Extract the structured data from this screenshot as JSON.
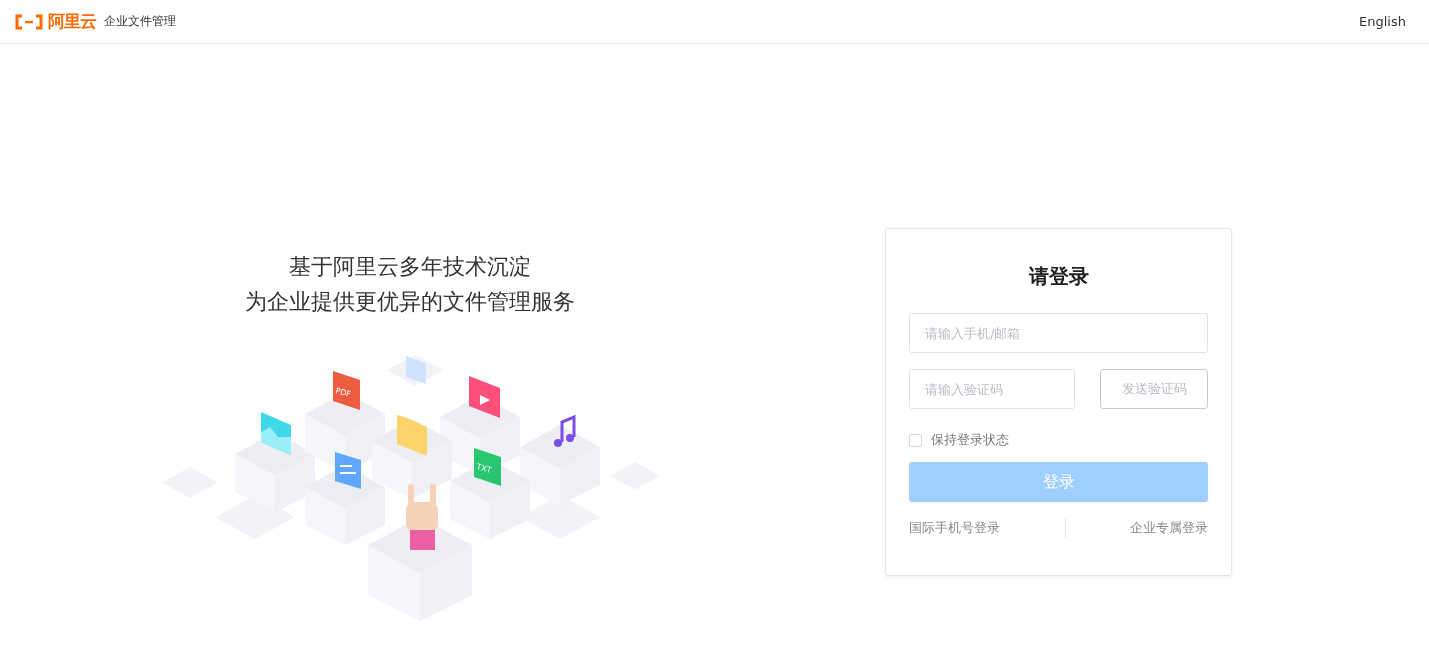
{
  "header": {
    "brand": "阿里云",
    "product": "企业文件管理",
    "language": "English"
  },
  "slogan": [
    "基于阿里云多年技术沉淀",
    "为企业提供更优异的文件管理服务"
  ],
  "illustration": {
    "labels": [
      "PDF",
      "TXT"
    ]
  },
  "login": {
    "title": "请登录",
    "account": {
      "placeholder": "请输入手机/邮箱"
    },
    "code": {
      "placeholder": "请输入验证码"
    },
    "send_code": "发送验证码",
    "remember": {
      "label": "保持登录状态",
      "checked": false
    },
    "submit": {
      "label": "登录",
      "disabled": true
    },
    "links": [
      "国际手机号登录",
      "企业专属登录"
    ]
  }
}
